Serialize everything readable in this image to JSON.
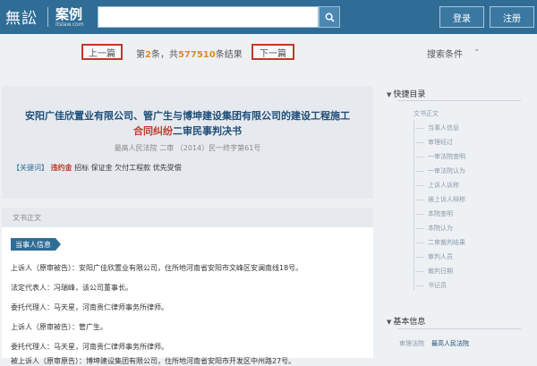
{
  "header": {
    "logo_mark": "無訟",
    "logo_name": "案例",
    "logo_url": "itslaw.com",
    "search_value": "",
    "login_label": "登录",
    "register_label": "注册"
  },
  "pager": {
    "prev_label": "上一篇",
    "next_label": "下一篇",
    "result_prefix": "第",
    "current_index": "2",
    "result_mid": "条，共",
    "total": "577510",
    "result_suffix": "条结果",
    "filter_label": "搜索条件",
    "filter_chevron": "⌄"
  },
  "case": {
    "title_line1": "安阳广佳欣置业有限公司、管广生与博坤建设集团有限公司的建设工程施工",
    "title_line2_highlight": "合同纠纷",
    "title_line2_rest": "二审民事判决书",
    "meta": "最高人民法院    二审    （2014）民一终字第61号",
    "keywords_label": "【关键词】",
    "keyword_highlight": "违约金",
    "keywords_rest": "招标 保证金 欠付工程款 优先受偿"
  },
  "document": {
    "section_title": "文书正文",
    "party_badge": "当事人信息",
    "lines": [
      "上诉人（原审被告）：安阳广佳欣置业有限公司，住所地河南省安阳市文峰区安澜南线18号。",
      "法定代表人：冯瑞峰，该公司董事长。",
      "委托代理人：马天星，河南贵仁律师事务所律师。",
      "上诉人（原审被告）：管广生。",
      "委托代理人：马天星，河南贵仁律师事务所律师。",
      "被上诉人（原审原告）：博坤建设集团有限公司，住所地河南省安阳市开发区中州路27号。"
    ]
  },
  "sidebar": {
    "toc_title": "快捷目录",
    "toc_root": "文书正文",
    "toc_items": [
      "当事人信息",
      "审理经过",
      "一审法院查明",
      "一审法院认为",
      "上诉人诉称",
      "被上诉人辩称",
      "本院查明",
      "本院认为",
      "二审裁判结果",
      "审判人员",
      "裁判日期",
      "书记员"
    ],
    "info_title": "基本信息",
    "info_key": "审理法院",
    "info_value": "最高人民法院"
  }
}
